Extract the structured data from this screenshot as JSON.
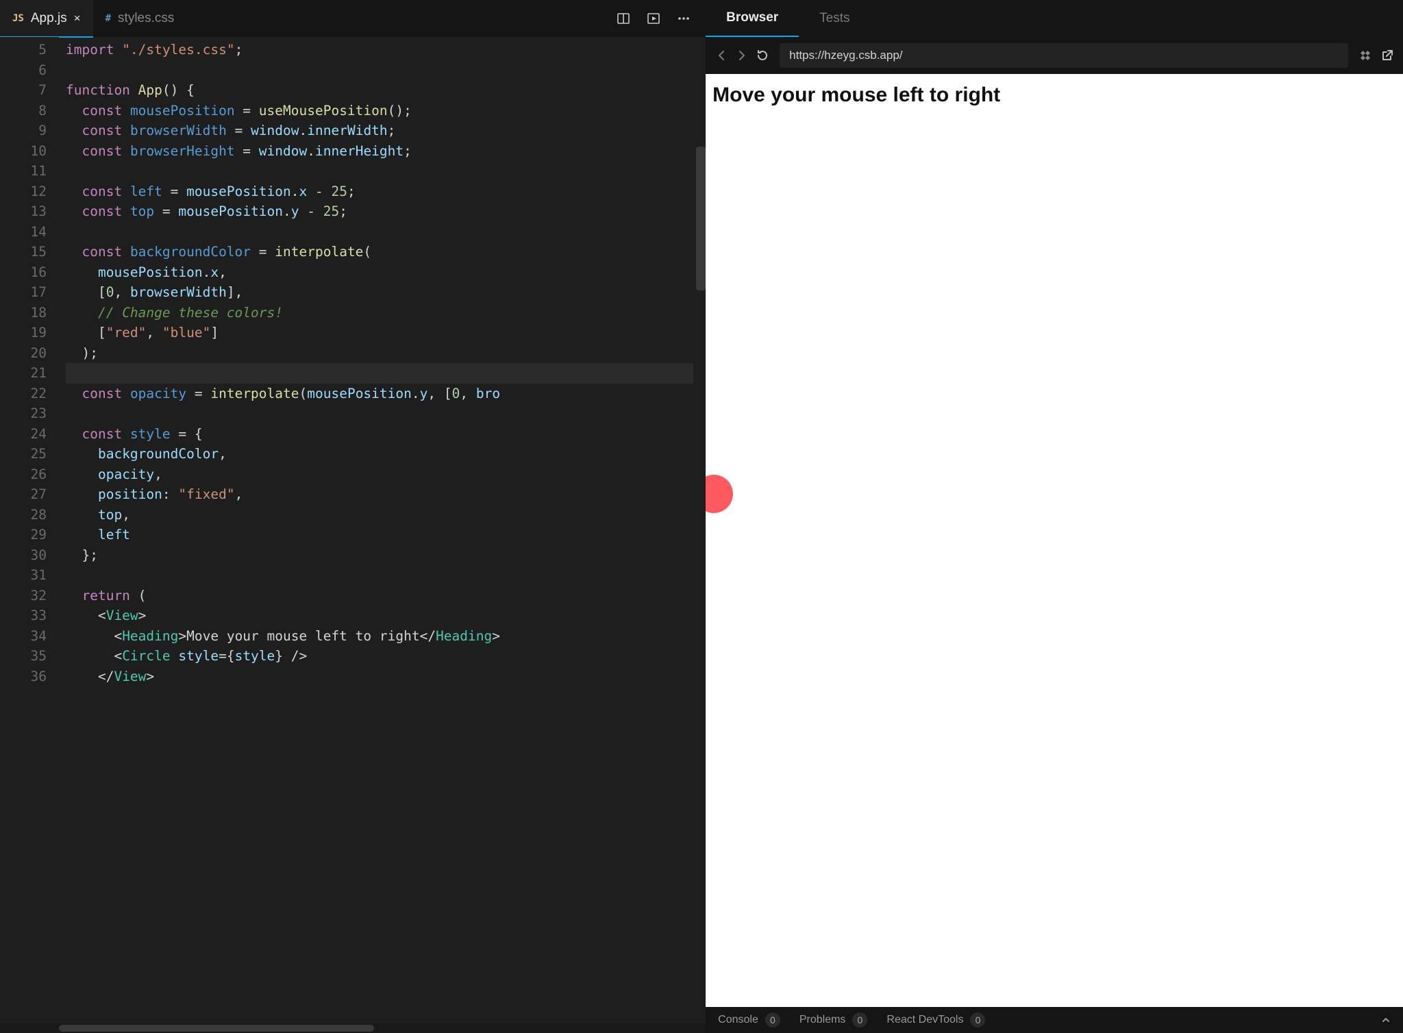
{
  "editor": {
    "tabs": [
      {
        "badge": "JS",
        "label": "App.js",
        "active": true,
        "closeable": true
      },
      {
        "badge": "#",
        "label": "styles.css",
        "active": false,
        "closeable": false
      }
    ],
    "first_line_number": 5,
    "active_line_number": 21,
    "code_lines": [
      [
        [
          "kw",
          "import"
        ],
        [
          "pun",
          " "
        ],
        [
          "str",
          "\"./styles.css\""
        ],
        [
          "pun",
          ";"
        ]
      ],
      [],
      [
        [
          "kw",
          "function"
        ],
        [
          "pun",
          " "
        ],
        [
          "fn",
          "App"
        ],
        [
          "pun",
          "() {"
        ]
      ],
      [
        [
          "pun",
          "  "
        ],
        [
          "kw",
          "const"
        ],
        [
          "pun",
          " "
        ],
        [
          "def",
          "mousePosition"
        ],
        [
          "pun",
          " = "
        ],
        [
          "fn",
          "useMousePosition"
        ],
        [
          "pun",
          "();"
        ]
      ],
      [
        [
          "pun",
          "  "
        ],
        [
          "kw",
          "const"
        ],
        [
          "pun",
          " "
        ],
        [
          "def",
          "browserWidth"
        ],
        [
          "pun",
          " = "
        ],
        [
          "id",
          "window"
        ],
        [
          "pun",
          "."
        ],
        [
          "id",
          "innerWidth"
        ],
        [
          "pun",
          ";"
        ]
      ],
      [
        [
          "pun",
          "  "
        ],
        [
          "kw",
          "const"
        ],
        [
          "pun",
          " "
        ],
        [
          "def",
          "browserHeight"
        ],
        [
          "pun",
          " = "
        ],
        [
          "id",
          "window"
        ],
        [
          "pun",
          "."
        ],
        [
          "id",
          "innerHeight"
        ],
        [
          "pun",
          ";"
        ]
      ],
      [],
      [
        [
          "pun",
          "  "
        ],
        [
          "kw",
          "const"
        ],
        [
          "pun",
          " "
        ],
        [
          "def",
          "left"
        ],
        [
          "pun",
          " = "
        ],
        [
          "id",
          "mousePosition"
        ],
        [
          "pun",
          "."
        ],
        [
          "id",
          "x"
        ],
        [
          "pun",
          " - "
        ],
        [
          "num",
          "25"
        ],
        [
          "pun",
          ";"
        ]
      ],
      [
        [
          "pun",
          "  "
        ],
        [
          "kw",
          "const"
        ],
        [
          "pun",
          " "
        ],
        [
          "def",
          "top"
        ],
        [
          "pun",
          " = "
        ],
        [
          "id",
          "mousePosition"
        ],
        [
          "pun",
          "."
        ],
        [
          "id",
          "y"
        ],
        [
          "pun",
          " - "
        ],
        [
          "num",
          "25"
        ],
        [
          "pun",
          ";"
        ]
      ],
      [],
      [
        [
          "pun",
          "  "
        ],
        [
          "kw",
          "const"
        ],
        [
          "pun",
          " "
        ],
        [
          "def",
          "backgroundColor"
        ],
        [
          "pun",
          " = "
        ],
        [
          "fn",
          "interpolate"
        ],
        [
          "pun",
          "("
        ]
      ],
      [
        [
          "pun",
          "    "
        ],
        [
          "id",
          "mousePosition"
        ],
        [
          "pun",
          "."
        ],
        [
          "id",
          "x"
        ],
        [
          "pun",
          ","
        ]
      ],
      [
        [
          "pun",
          "    ["
        ],
        [
          "num",
          "0"
        ],
        [
          "pun",
          ", "
        ],
        [
          "id",
          "browserWidth"
        ],
        [
          "pun",
          "],"
        ]
      ],
      [
        [
          "pun",
          "    "
        ],
        [
          "cmt",
          "// Change these colors!"
        ]
      ],
      [
        [
          "pun",
          "    ["
        ],
        [
          "str",
          "\"red\""
        ],
        [
          "pun",
          ", "
        ],
        [
          "str",
          "\"blue\""
        ],
        [
          "pun",
          "]"
        ]
      ],
      [
        [
          "pun",
          "  );"
        ]
      ],
      [],
      [
        [
          "pun",
          "  "
        ],
        [
          "kw",
          "const"
        ],
        [
          "pun",
          " "
        ],
        [
          "def",
          "opacity"
        ],
        [
          "pun",
          " = "
        ],
        [
          "fn",
          "interpolate"
        ],
        [
          "pun",
          "("
        ],
        [
          "id",
          "mousePosition"
        ],
        [
          "pun",
          "."
        ],
        [
          "id",
          "y"
        ],
        [
          "pun",
          ", ["
        ],
        [
          "num",
          "0"
        ],
        [
          "pun",
          ", "
        ],
        [
          "id",
          "bro"
        ]
      ],
      [],
      [
        [
          "pun",
          "  "
        ],
        [
          "kw",
          "const"
        ],
        [
          "pun",
          " "
        ],
        [
          "def",
          "style"
        ],
        [
          "pun",
          " = {"
        ]
      ],
      [
        [
          "pun",
          "    "
        ],
        [
          "id",
          "backgroundColor"
        ],
        [
          "pun",
          ","
        ]
      ],
      [
        [
          "pun",
          "    "
        ],
        [
          "id",
          "opacity"
        ],
        [
          "pun",
          ","
        ]
      ],
      [
        [
          "pun",
          "    "
        ],
        [
          "id",
          "position"
        ],
        [
          "pun",
          ": "
        ],
        [
          "str",
          "\"fixed\""
        ],
        [
          "pun",
          ","
        ]
      ],
      [
        [
          "pun",
          "    "
        ],
        [
          "id",
          "top"
        ],
        [
          "pun",
          ","
        ]
      ],
      [
        [
          "pun",
          "    "
        ],
        [
          "id",
          "left"
        ]
      ],
      [
        [
          "pun",
          "  };"
        ]
      ],
      [],
      [
        [
          "pun",
          "  "
        ],
        [
          "kw",
          "return"
        ],
        [
          "pun",
          " ("
        ]
      ],
      [
        [
          "pun",
          "    <"
        ],
        [
          "tag",
          "View"
        ],
        [
          "pun",
          ">"
        ]
      ],
      [
        [
          "pun",
          "      <"
        ],
        [
          "tag",
          "Heading"
        ],
        [
          "pun",
          ">"
        ],
        [
          "prop",
          "Move your mouse left to right"
        ],
        [
          "pun",
          "</"
        ],
        [
          "tag",
          "Heading"
        ],
        [
          "pun",
          ">"
        ]
      ],
      [
        [
          "pun",
          "      <"
        ],
        [
          "tag",
          "Circle"
        ],
        [
          "pun",
          " "
        ],
        [
          "attr",
          "style"
        ],
        [
          "pun",
          "={"
        ],
        [
          "id",
          "style"
        ],
        [
          "pun",
          "} />"
        ]
      ],
      [
        [
          "pun",
          "    </"
        ],
        [
          "tag",
          "View"
        ],
        [
          "pun",
          ">"
        ]
      ]
    ]
  },
  "preview": {
    "tabs": [
      {
        "label": "Browser",
        "active": true
      },
      {
        "label": "Tests",
        "active": false
      }
    ],
    "url": "https://hzeyg.csb.app/",
    "heading": "Move your mouse left to right",
    "circle_color": "#ff5a5f"
  },
  "bottombar": {
    "items": [
      {
        "label": "Console",
        "count": "0"
      },
      {
        "label": "Problems",
        "count": "0"
      },
      {
        "label": "React DevTools",
        "count": "0"
      }
    ]
  }
}
